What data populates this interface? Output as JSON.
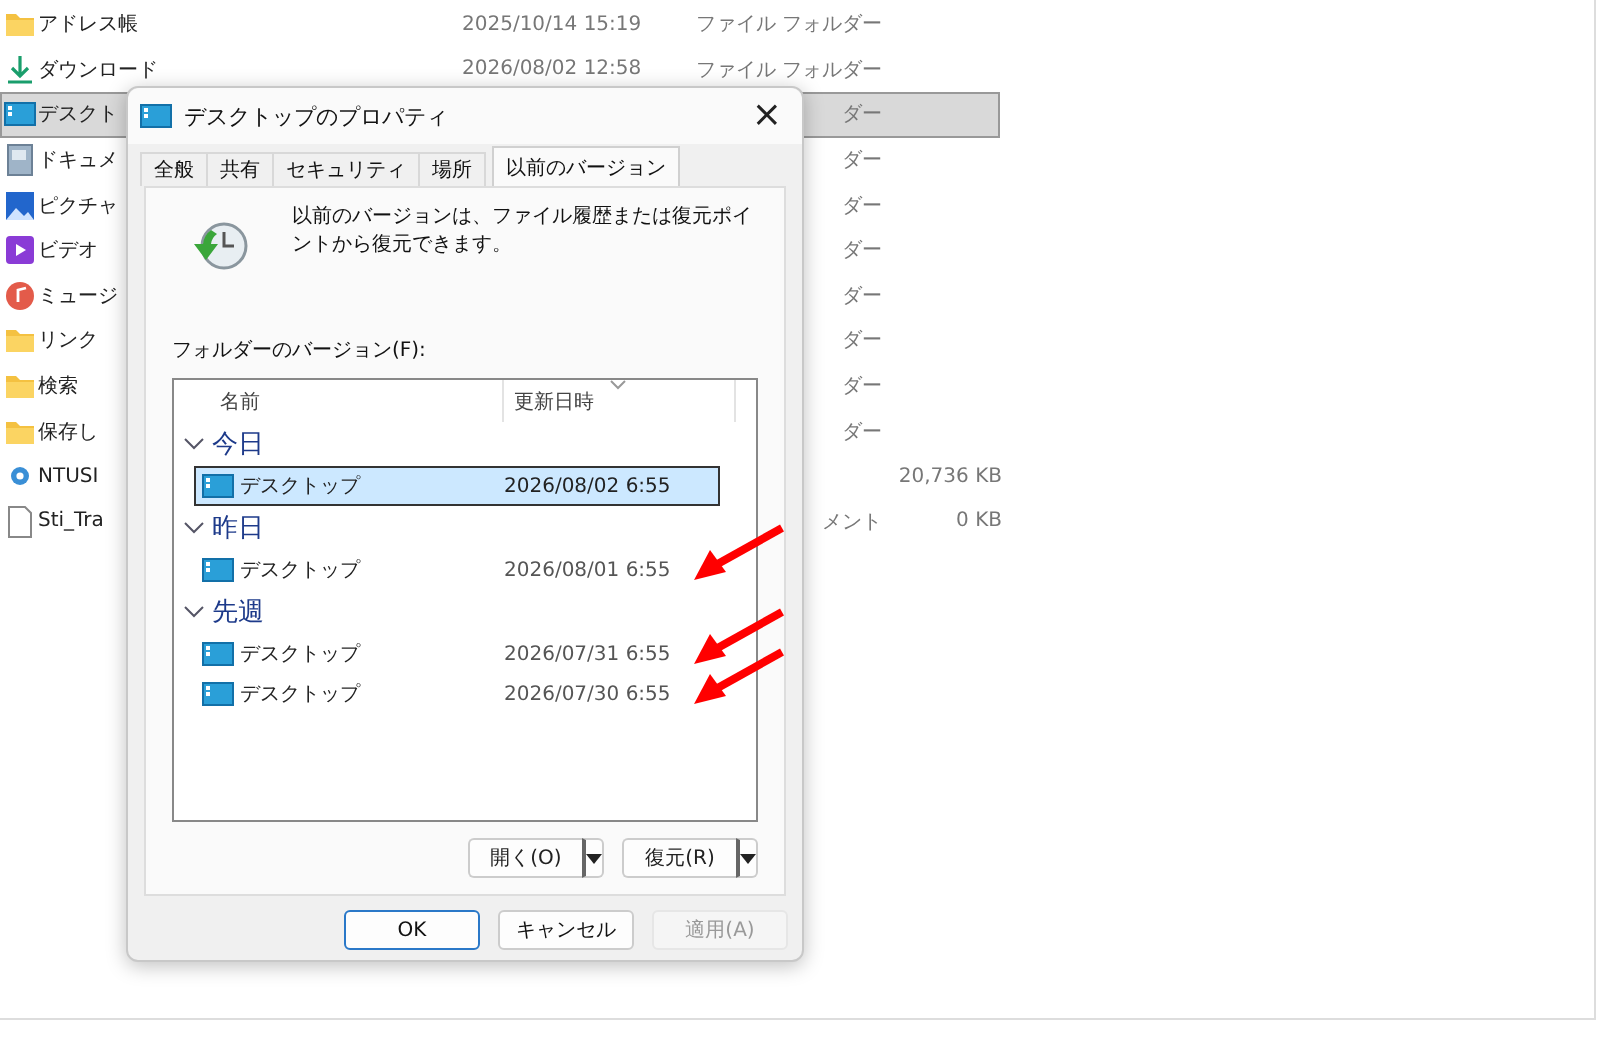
{
  "explorer": {
    "rows": [
      {
        "kind": "folder",
        "name": "アドレス帳",
        "date": "2025/10/14 15:19",
        "type": "ファイル フォルダー",
        "selected": false
      },
      {
        "kind": "download",
        "name": "ダウンロード",
        "date": "2026/08/02 12:58",
        "type": "ファイル フォルダー",
        "selected": false
      },
      {
        "kind": "desktop",
        "name": "デスクト",
        "type": "ダー",
        "selected": true
      },
      {
        "kind": "document",
        "name": "ドキュメ",
        "type": "ダー",
        "selected": false
      },
      {
        "kind": "picture",
        "name": "ピクチャ",
        "type": "ダー",
        "selected": false
      },
      {
        "kind": "video",
        "name": "ビデオ",
        "type": "ダー",
        "selected": false
      },
      {
        "kind": "music",
        "name": "ミュージ",
        "type": "ダー",
        "selected": false
      },
      {
        "kind": "folder",
        "name": "リンク",
        "type": "ダー",
        "selected": false
      },
      {
        "kind": "folder",
        "name": "検索",
        "type": "ダー",
        "selected": false
      },
      {
        "kind": "folder",
        "name": "保存し",
        "type": "ダー",
        "selected": false
      },
      {
        "kind": "disc",
        "name": "NTUSI",
        "size": "20,736 KB",
        "selected": false
      },
      {
        "kind": "file",
        "name": "Sti_Tra",
        "type": "メント",
        "size": "0 KB",
        "selected": false
      }
    ]
  },
  "dialog": {
    "title": "デスクトップのプロパティ",
    "close": "×",
    "tabs": [
      {
        "label": "全般",
        "selected": false
      },
      {
        "label": "共有",
        "selected": false
      },
      {
        "label": "セキュリティ",
        "selected": false
      },
      {
        "label": "場所",
        "selected": false
      },
      {
        "label": "以前のバージョン",
        "selected": true
      }
    ],
    "description": "以前のバージョンは、ファイル履歴または復元ポイントから復元できます。",
    "list_label": "フォルダーのバージョン(F):",
    "columns": [
      "名前",
      "更新日時"
    ],
    "groups": [
      {
        "label": "今日",
        "expanded": true,
        "items": [
          {
            "name": "デスクトップ",
            "date": "2026/08/02 6:55",
            "selected": true,
            "marked": false
          }
        ]
      },
      {
        "label": "昨日",
        "expanded": true,
        "items": [
          {
            "name": "デスクトップ",
            "date": "2026/08/01 6:55",
            "selected": false,
            "marked": true
          }
        ]
      },
      {
        "label": "先週",
        "expanded": true,
        "items": [
          {
            "name": "デスクトップ",
            "date": "2026/07/31 6:55",
            "selected": false,
            "marked": true
          },
          {
            "name": "デスクトップ",
            "date": "2026/07/30 6:55",
            "selected": false,
            "marked": true
          }
        ]
      }
    ],
    "split_buttons": [
      {
        "label": "開く(O)"
      },
      {
        "label": "復元(R)"
      }
    ],
    "buttons": [
      {
        "label": "OK",
        "default": true,
        "disabled": false
      },
      {
        "label": "キャンセル",
        "default": false,
        "disabled": false
      },
      {
        "label": "適用(A)",
        "default": false,
        "disabled": true
      }
    ]
  }
}
